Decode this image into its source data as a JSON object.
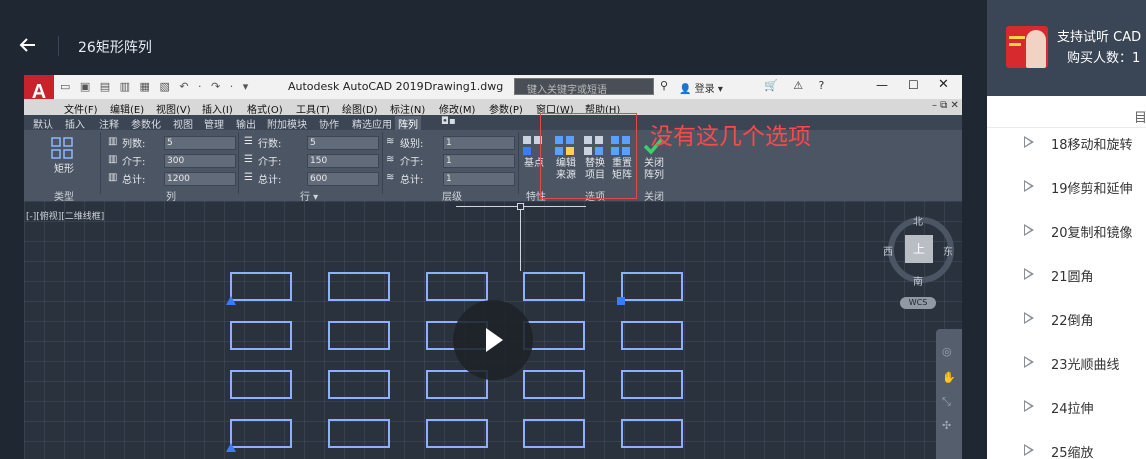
{
  "header": {
    "back_icon": "arrow-left-icon",
    "title": "26矩形阵列"
  },
  "acad": {
    "app_letter": "A",
    "quick_access": "▭ ▣ ▤ ▥ ▦ ▧ ↶ · ↷ · ▾",
    "app_name": "Autodesk AutoCAD 2019",
    "doc_name": "Drawing1.dwg",
    "search_placeholder": "键入关键字或短语",
    "login": "登录",
    "menus": [
      "文件(F)",
      "编辑(E)",
      "视图(V)",
      "插入(I)",
      "格式(O)",
      "工具(T)",
      "绘图(D)",
      "标注(N)",
      "修改(M)",
      "参数(P)",
      "窗口(W)",
      "帮助(H)"
    ],
    "tabs": [
      "默认",
      "插入",
      "注释",
      "参数化",
      "视图",
      "管理",
      "输出",
      "附加模块",
      "协作",
      "精选应用",
      "阵列"
    ],
    "active_tab": "阵列",
    "tab_extra": "◘▪",
    "ribbon": {
      "type_btn": "矩形",
      "type_panel": "类型",
      "col_panel": "列",
      "row_panel": "行 ▾",
      "level_panel": "层级",
      "prop_panel": "特性",
      "options_panel": "选项",
      "close_panel": "关闭",
      "labels": {
        "columns": "列数:",
        "col_between": "介于:",
        "col_total": "总计:",
        "rows": "行数:",
        "row_between": "介于:",
        "row_total": "总计:",
        "levels": "级别:",
        "lvl_between": "介于:",
        "lvl_total": "总计:"
      },
      "values": {
        "columns": "5",
        "col_between": "300",
        "col_total": "1200",
        "rows": "5",
        "row_between": "150",
        "row_total": "600",
        "levels": "1",
        "lvl_between": "1",
        "lvl_total": "1"
      },
      "base_point_btn": "基点",
      "edit_source_btn": [
        "编辑",
        "来源"
      ],
      "replace_item_btn": [
        "替换",
        "项目"
      ],
      "reset_array_btn": [
        "重置",
        "矩阵"
      ],
      "close_array_btn": [
        "关闭",
        "阵列"
      ]
    },
    "annotation": "没有这几个选项",
    "viewport_label": "[-][俯视][二维线框]",
    "viewcube": {
      "top": "上",
      "north": "北",
      "south": "南",
      "west": "西",
      "east": "东"
    },
    "wcs": "WCS"
  },
  "sidebar": {
    "course_title": "支持试听 CAD",
    "buyers": "购买人数：1",
    "tab_label": "目",
    "lessons": [
      "18移动和旋转",
      "19修剪和延伸",
      "20复制和镜像",
      "21圆角",
      "22倒角",
      "23光顺曲线",
      "24拉伸",
      "25缩放"
    ]
  },
  "colors": {
    "annotation_red": "#ff4848",
    "rect_blue": "#8fb0ff",
    "grip_blue": "#3b7cff",
    "autocad_red": "#c8232c"
  }
}
